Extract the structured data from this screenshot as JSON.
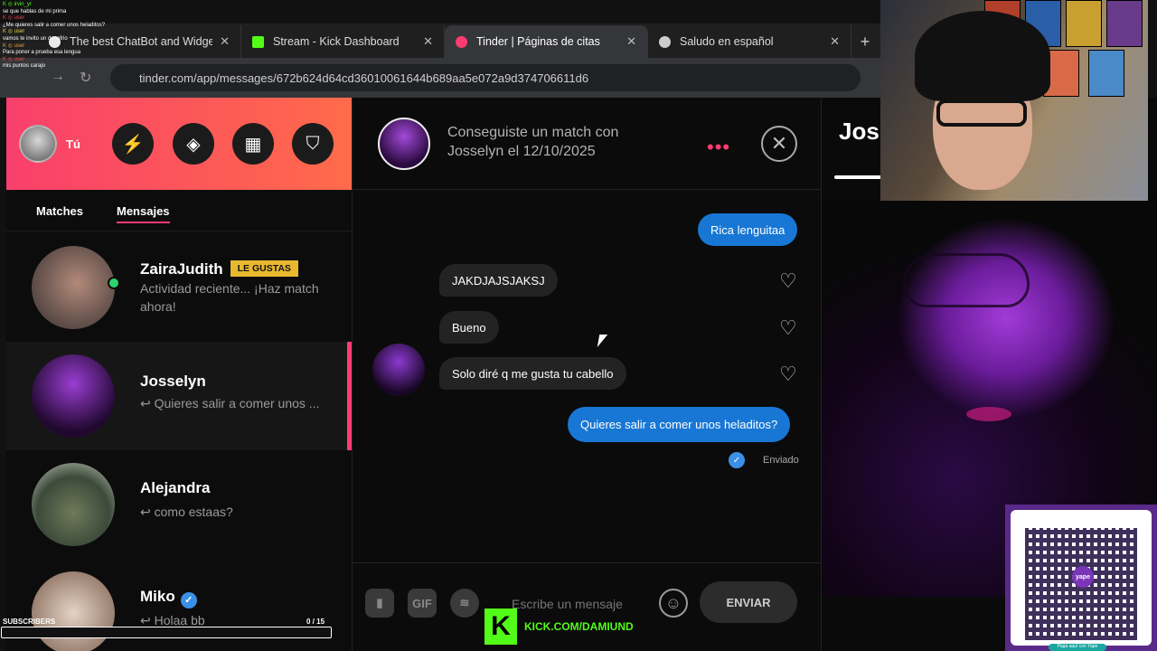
{
  "browser": {
    "tabs": [
      {
        "label": "The best ChatBot and Widgets",
        "fav_color": "#e9e9e9"
      },
      {
        "label": "Stream - Kick Dashboard",
        "fav_color": "#53fc18"
      },
      {
        "label": "Tinder | Páginas de citas",
        "fav_color": "#fe3c72"
      },
      {
        "label": "Saludo en español",
        "fav_color": "#cccccc"
      }
    ],
    "new_tab": "+",
    "tab_close": "✕",
    "url": "tinder.com/app/messages/672b624d64cd36010061644b689aa5e072a9d374706611d6"
  },
  "sidebar": {
    "me_label": "Tú",
    "tabs": [
      "Matches",
      "Mensajes"
    ],
    "conversations": [
      {
        "name": "ZairaJudith",
        "badge": "LE GUSTAS",
        "preview": "Actividad reciente... ¡Haz match ahora!",
        "online": true
      },
      {
        "name": "Josselyn",
        "preview": "Quieres salir a comer unos ..."
      },
      {
        "name": "Alejandra",
        "preview": "como estaas?"
      },
      {
        "name": "Miko",
        "preview": "Holaa bb",
        "verified": true
      }
    ]
  },
  "chat": {
    "header_text": "Conseguiste un match con Josselyn el 12/10/2025",
    "dots": "•••",
    "close": "✕",
    "messages": [
      {
        "text": "Rica lenguitaa",
        "dir": "out"
      },
      {
        "text": "JAKDJAJSJAKSJ",
        "dir": "in"
      },
      {
        "text": "Bueno",
        "dir": "in"
      },
      {
        "text": "Solo diré q me gusta tu cabello",
        "dir": "in"
      },
      {
        "text": "Quieres salir a comer unos heladitos?",
        "dir": "out"
      }
    ],
    "sent_label": "Enviado",
    "input_placeholder": "Escribe un mensaje",
    "gif_label": "GIF",
    "send_label": "ENVIAR"
  },
  "profile": {
    "name": "Jos"
  },
  "overlay": {
    "chat_lines": [
      "se que hablas de mi prima",
      "¿Me quieres salir a comer unos heladitos?",
      "vamos te invito un donofrio",
      "Para poner a prueba esa lengua",
      "mis puntos carajo"
    ],
    "subscribers_label": "SUBSCRIBERS",
    "subscribers_count": "0 / 15",
    "kick_url": "KICK.COM/DAMIUND",
    "qr_logo": "yape",
    "qr_caption": "Paga aquí con Yape"
  }
}
